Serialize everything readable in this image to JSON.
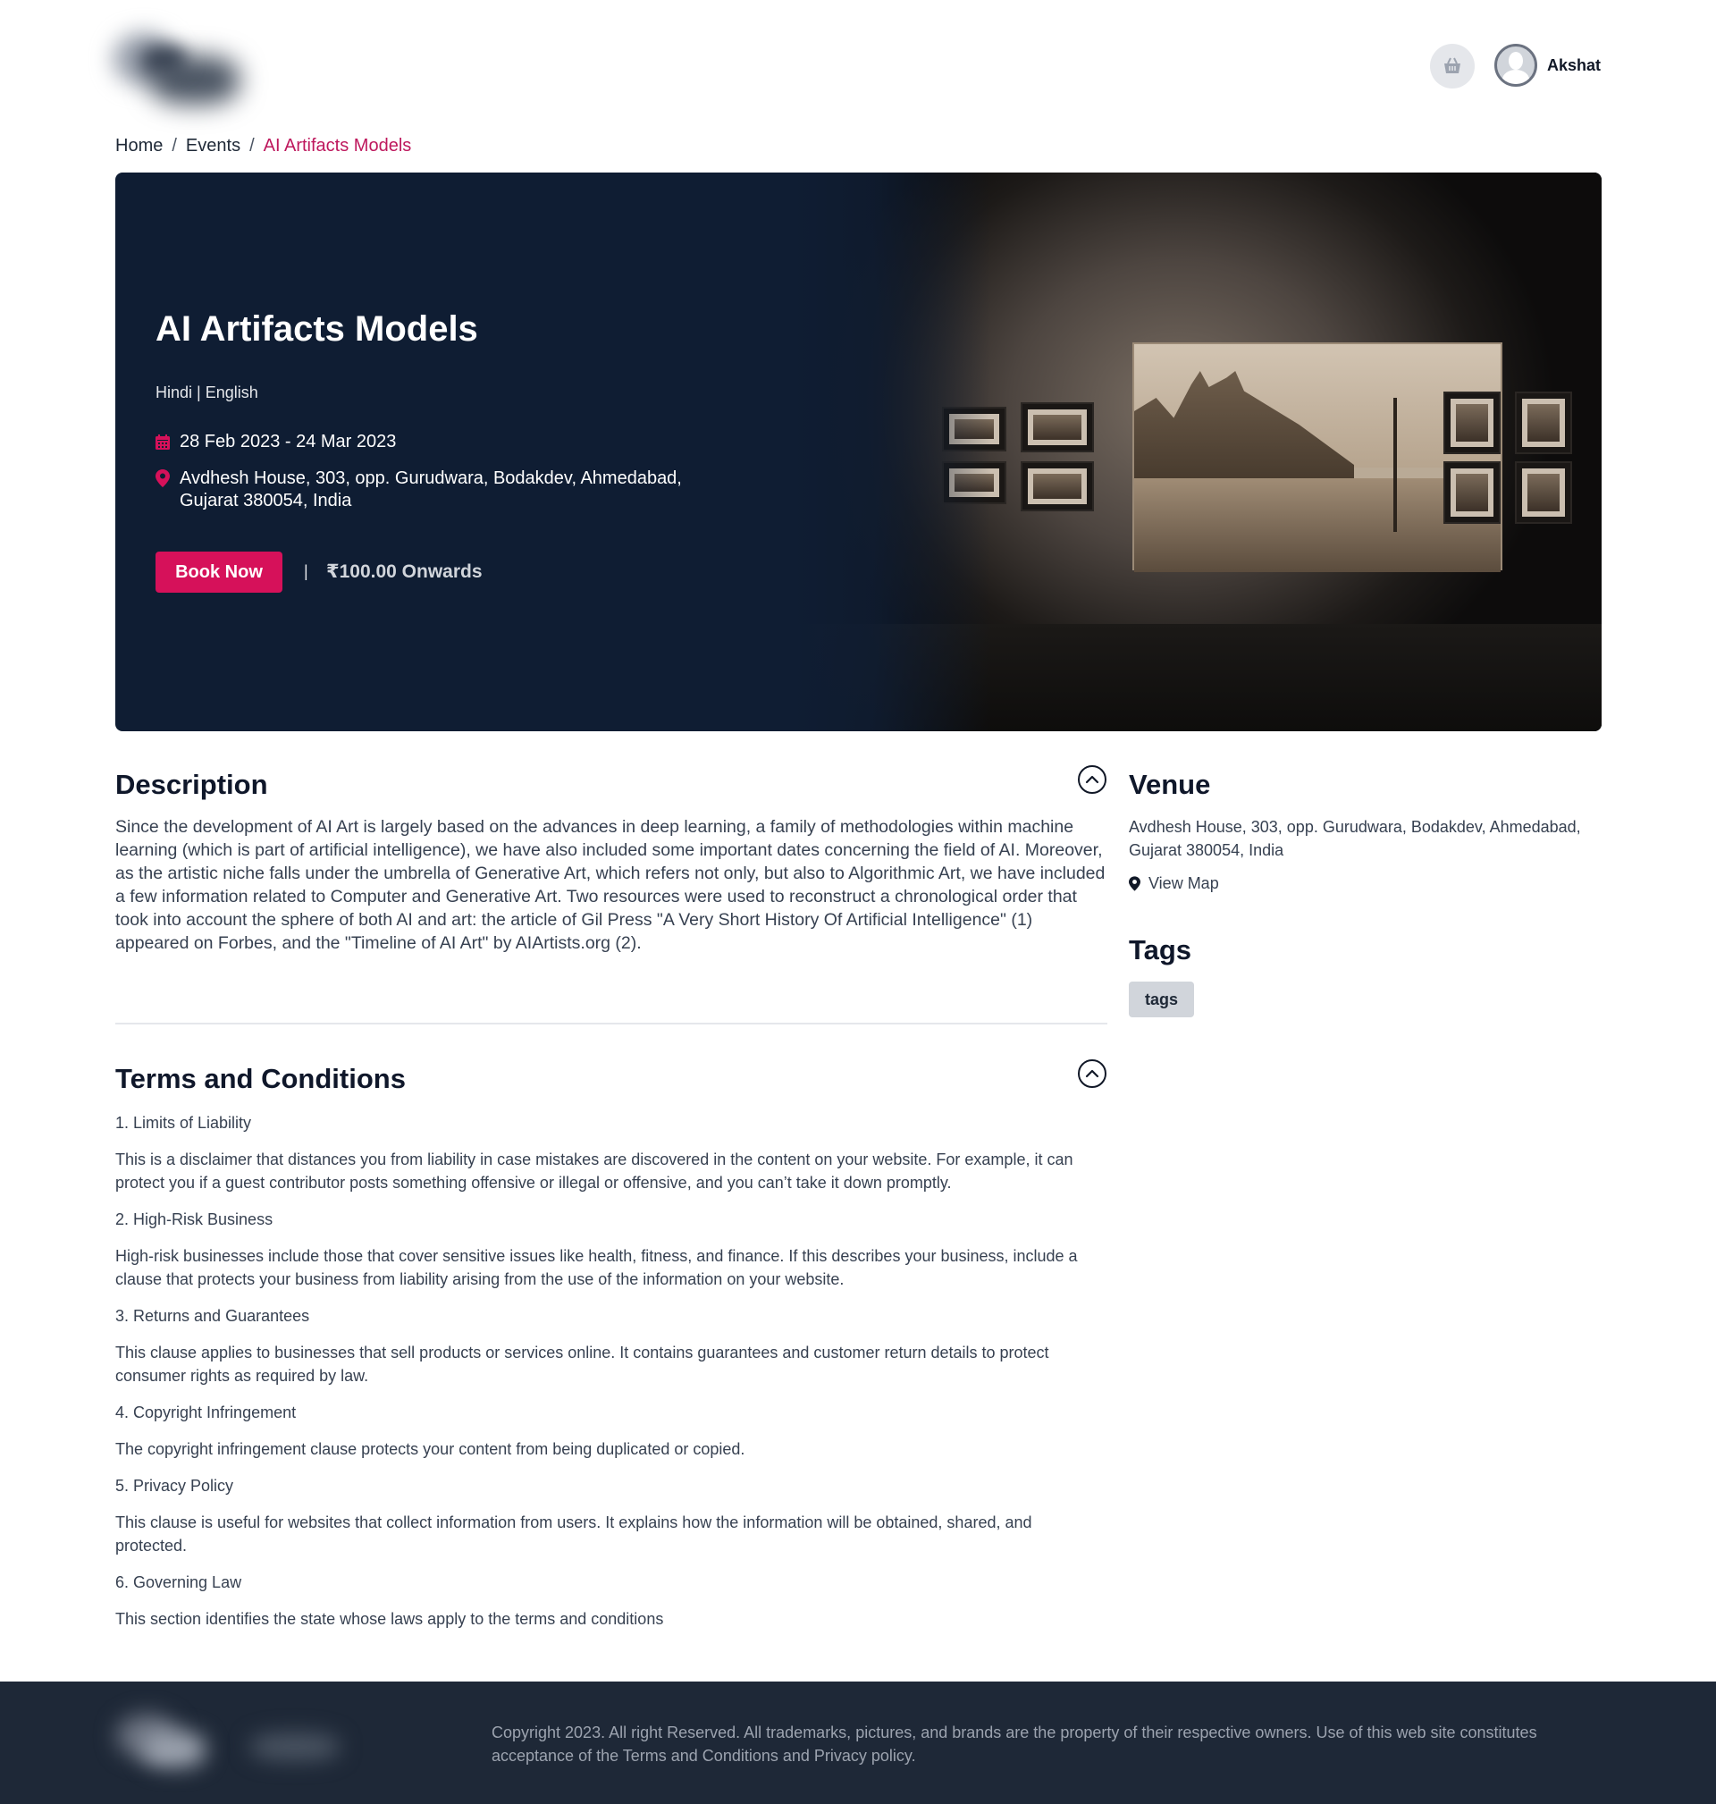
{
  "header": {
    "username": "Akshat",
    "cart_icon": "shopping-basket-icon",
    "avatar_icon": "user-avatar-icon"
  },
  "breadcrumb": {
    "items": [
      "Home",
      "Events",
      "AI Artifacts Models"
    ],
    "separator": "/"
  },
  "hero": {
    "title": "AI Artifacts Models",
    "languages": "Hindi | English",
    "date_range": "28 Feb 2023 - 24 Mar 2023",
    "address": "Avdhesh House, 303, opp. Gurudwara, Bodakdev, Ahmedabad, Gujarat 380054, India",
    "book_label": "Book Now",
    "separator": "|",
    "price": "₹100.00 Onwards"
  },
  "description": {
    "title": "Description",
    "text": "Since the development of AI Art is largely based on the advances in deep learning, a family of methodologies within machine learning (which is part of artificial intelligence), we have also included some important dates concerning the field of AI. Moreover, as the artistic niche falls under the umbrella of Generative Art, which refers not only, but also to Algorithmic Art, we have included a few information related to Computer and Generative Art. Two resources were used to reconstruct a chronological order that took into account the sphere of both AI and art: the article of Gil Press \"A Very Short History Of Artificial Intelligence\" (1) appeared on Forbes, and the \"Timeline of AI Art\" by AIArtists.org (2)."
  },
  "terms": {
    "title": "Terms and Conditions",
    "items": [
      {
        "heading": "1. Limits of Liability",
        "body": "This is a disclaimer that distances you from liability in case mistakes are discovered in the content on your website. For example, it can protect you if a guest contributor posts something offensive or illegal or offensive, and you can’t take it down promptly."
      },
      {
        "heading": "2. High-Risk Business",
        "body": "High-risk businesses include those that cover sensitive issues like health, fitness, and finance. If this describes your business, include a clause that protects your business from liability arising from the use of the information on your website."
      },
      {
        "heading": "3. Returns and Guarantees",
        "body": "This clause applies to businesses that sell products or services online. It contains guarantees and customer return details to protect consumer rights as required by law."
      },
      {
        "heading": "4. Copyright Infringement",
        "body": "The copyright infringement clause protects your content from being duplicated or copied."
      },
      {
        "heading": "5. Privacy Policy",
        "body": "This clause is useful for websites that collect information from users. It explains how the information will be obtained, shared, and protected."
      },
      {
        "heading": "6. Governing Law",
        "body": "This section identifies the state whose laws apply to the terms and conditions"
      }
    ]
  },
  "venue": {
    "title": "Venue",
    "address": "Avdhesh House, 303, opp. Gurudwara, Bodakdev, Ahmedabad, Gujarat 380054, India",
    "view_map_label": "View Map"
  },
  "tags": {
    "title": "Tags",
    "items": [
      "tags"
    ]
  },
  "footer": {
    "copyright": "Copyright 2023. All right Reserved. All trademarks, pictures, and brands are the property of their respective owners. Use of this web site constitutes acceptance of the Terms and Conditions and Privacy policy."
  },
  "colors": {
    "accent": "#d6115a",
    "breadcrumb_active": "#be185d",
    "hero_bg": "#0f1d33",
    "footer_bg": "#1e2837"
  }
}
